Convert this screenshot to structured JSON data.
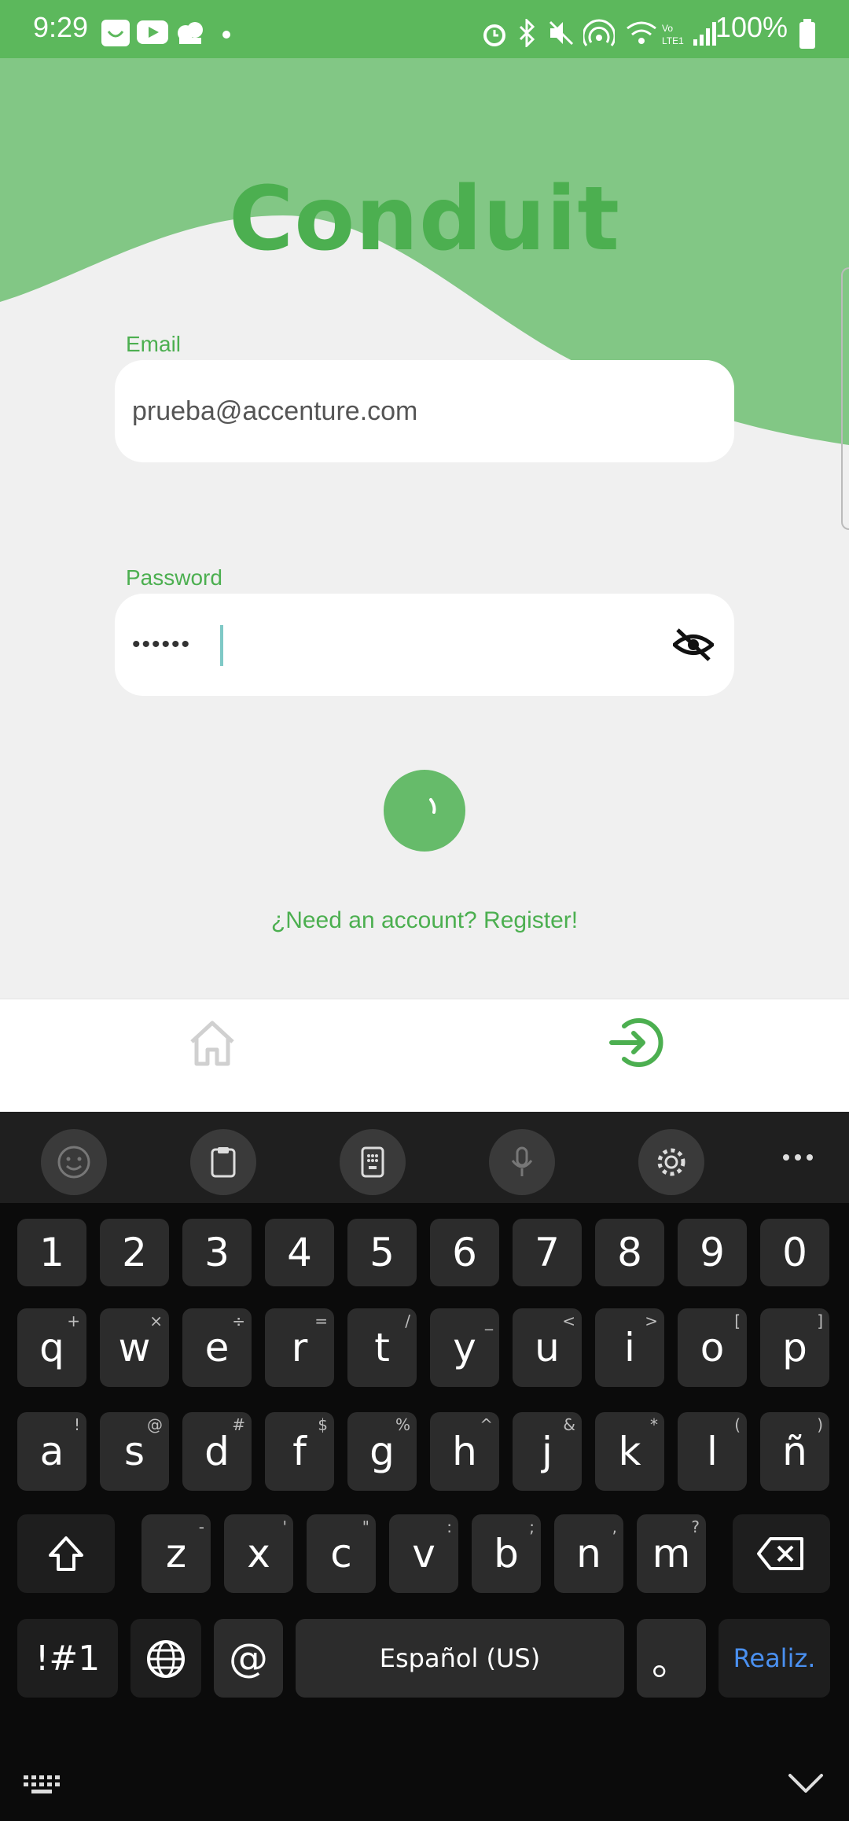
{
  "status_bar": {
    "time": "9:29",
    "battery": "100%",
    "icons": [
      "app-icon",
      "youtube-icon",
      "game-icon",
      "dot-icon",
      "alarm-icon",
      "bluetooth-icon",
      "mute-icon",
      "hotspot-icon",
      "wifi-icon",
      "volte-icon",
      "signal-icon",
      "battery-icon"
    ]
  },
  "app": {
    "title": "Conduit",
    "email": {
      "label": "Email",
      "value": "prueba@accenture.com"
    },
    "password": {
      "label": "Password",
      "value": "••••••"
    },
    "register_link": "¿Need an account? Register!",
    "accent_color": "#4caf50"
  },
  "nav": {
    "items": [
      {
        "icon": "home-icon",
        "active": false
      },
      {
        "icon": "login-icon",
        "active": true
      }
    ]
  },
  "keyboard": {
    "toolbar": [
      "emoji-icon",
      "clipboard-icon",
      "keypad-icon",
      "microphone-icon",
      "settings-icon",
      "more-icon"
    ],
    "row_numbers": [
      "1",
      "2",
      "3",
      "4",
      "5",
      "6",
      "7",
      "8",
      "9",
      "0"
    ],
    "row1": [
      {
        "k": "q",
        "s": "+"
      },
      {
        "k": "w",
        "s": "×"
      },
      {
        "k": "e",
        "s": "÷"
      },
      {
        "k": "r",
        "s": "="
      },
      {
        "k": "t",
        "s": "/"
      },
      {
        "k": "y",
        "s": "_"
      },
      {
        "k": "u",
        "s": "<"
      },
      {
        "k": "i",
        "s": ">"
      },
      {
        "k": "o",
        "s": "["
      },
      {
        "k": "p",
        "s": "]"
      }
    ],
    "row2": [
      {
        "k": "a",
        "s": "!"
      },
      {
        "k": "s",
        "s": "@"
      },
      {
        "k": "d",
        "s": "#"
      },
      {
        "k": "f",
        "s": "$"
      },
      {
        "k": "g",
        "s": "%"
      },
      {
        "k": "h",
        "s": "^"
      },
      {
        "k": "j",
        "s": "&"
      },
      {
        "k": "k",
        "s": "*"
      },
      {
        "k": "l",
        "s": "("
      },
      {
        "k": "ñ",
        "s": ")"
      }
    ],
    "row3": [
      {
        "k": "z",
        "s": "-"
      },
      {
        "k": "x",
        "s": "'"
      },
      {
        "k": "c",
        "s": "\""
      },
      {
        "k": "v",
        "s": ":"
      },
      {
        "k": "b",
        "s": ";"
      },
      {
        "k": "n",
        "s": ","
      },
      {
        "k": "m",
        "s": "?"
      }
    ],
    "symbols_label": "!#1",
    "at_label": "@",
    "space_label": "Español (US)",
    "period_label": "。",
    "done_label": "Realiz."
  }
}
